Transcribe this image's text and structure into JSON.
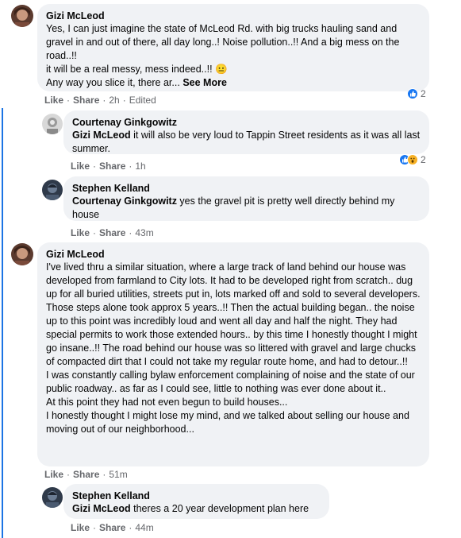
{
  "comments": [
    {
      "author": "Gizi McLeod",
      "text": "Yes, I can just imagine the state of McLeod Rd. with big trucks hauling sand and gravel in and out of there, all day long..! Noise pollution..!! And a big mess on the road..!!\nit will be a real messy, mess indeed..!! 😐\nAny way you slice it, there ar...",
      "see_more": "See More",
      "like": "Like",
      "share": "Share",
      "time": "2h",
      "edited": "Edited",
      "reaction_count": "2"
    },
    {
      "author": "Courtenay Ginkgowitz",
      "mention": "Gizi McLeod",
      "text": " it will also be very loud to Tappin Street residents as it was all last summer.",
      "like": "Like",
      "share": "Share",
      "time": "1h",
      "reaction_count": "2"
    },
    {
      "author": "Stephen Kelland",
      "mention": "Courtenay Ginkgowitz",
      "text": " yes the gravel pit is pretty well directly behind my house",
      "like": "Like",
      "share": "Share",
      "time": "43m"
    },
    {
      "author": "Gizi McLeod",
      "text": "I've lived thru a similar situation, where a large track of land behind our house was developed from farmland to City lots. It had to be developed right from scratch.. dug up for all buried utilities, streets put in, lots marked off and sold to several developers. Those steps alone took approx 5 years..!! Then the actual building began.. the noise up to this point was incredibly loud and went all day and half the night. They had special permits to work those extended hours.. by this time I honestly thought I might go insane..!! The road behind our house was so littered with gravel and large chucks of compacted dirt that I could not take my regular route home, and had to detour..!!\nI was constantly calling bylaw enforcement complaining of noise and the state of our public roadway.. as far as I could see, little to nothing was ever done about it..\nAt this point they had not even begun to build houses...\nI honestly thought I might lose my mind, and we talked about selling our house and moving out of our neighborhood...",
      "like": "Like",
      "share": "Share",
      "time": "51m"
    },
    {
      "author": "Stephen Kelland",
      "mention": "Gizi McLeod",
      "text": " theres a 20 year development plan here",
      "like": "Like",
      "share": "Share",
      "time": "44m"
    }
  ],
  "colors": {
    "thread_line": "#1b74e4",
    "bubble": "#f0f2f5",
    "like_blue": "#1877f2"
  }
}
